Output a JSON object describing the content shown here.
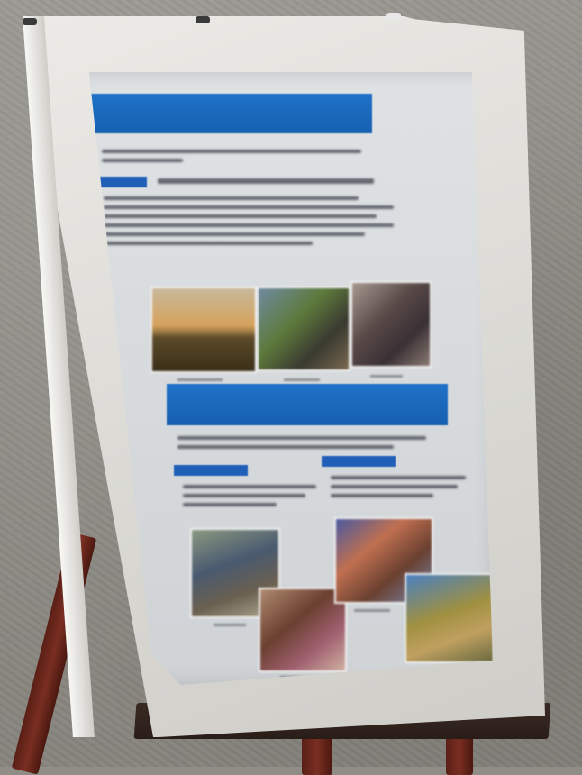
{
  "scene": {
    "subject": "poster on easel",
    "colors": {
      "wall": "#8f8d86",
      "board": "#e4e3df",
      "banner": "#1f6bc0",
      "easel": "#5a1f16"
    }
  },
  "poster": {
    "banner_top": {
      "line1": "",
      "line2": ""
    },
    "banner_mid": {
      "line1": "",
      "line2": ""
    },
    "photos_top": [
      "sunset-photo",
      "people-photo",
      "portrait-photo"
    ],
    "photos_left": [
      "street-photo",
      "group-photo"
    ],
    "photos_right": [
      "crowd-photo",
      "field-photo"
    ]
  }
}
